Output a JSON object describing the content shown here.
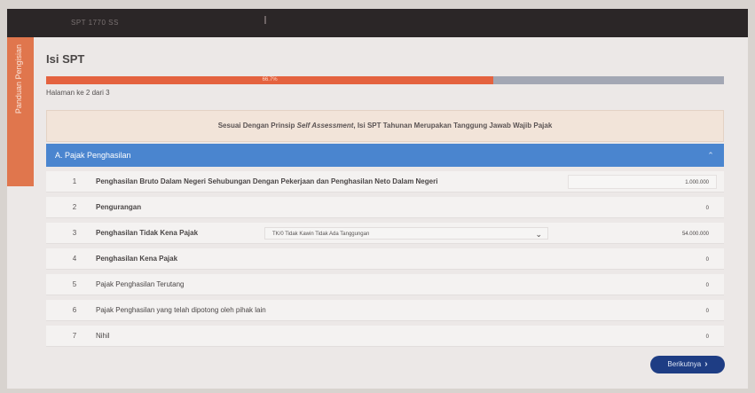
{
  "top_bar": {
    "brand": "SPT 1770 SS"
  },
  "side_tab": {
    "label": "Panduan Pengisian"
  },
  "page": {
    "title": "Isi SPT",
    "page_counter": "Halaman ke 2 dari 3"
  },
  "progress": {
    "percent": 66,
    "label": "66.7%"
  },
  "notice": {
    "prefix": "Sesuai Dengan Prinsip ",
    "emphasis": "Self Assessment",
    "suffix": ", Isi SPT Tahunan Merupakan Tanggung Jawab Wajib Pajak"
  },
  "section": {
    "title": "A. Pajak Penghasilan",
    "collapse_icon": "chevron-up-icon"
  },
  "rows": [
    {
      "num": "1",
      "label": "Penghasilan Bruto Dalam Negeri Sehubungan Dengan Pekerjaan dan Penghasilan Neto Dalam Negeri",
      "value": "1.000.000",
      "boxed": true
    },
    {
      "num": "2",
      "label": "Pengurangan",
      "value": "0",
      "boxed": false
    },
    {
      "num": "3",
      "label": "Penghasilan Tidak Kena Pajak",
      "value": "54.000.000",
      "boxed": false,
      "select_value": "TK/0 Tidak Kawin Tidak Ada Tanggungan"
    },
    {
      "num": "4",
      "label": "Penghasilan Kena Pajak",
      "value": "0",
      "boxed": false
    },
    {
      "num": "5",
      "label": "Pajak Penghasilan Terutang",
      "value": "0",
      "boxed": false
    },
    {
      "num": "6",
      "label": "Pajak Penghasilan yang telah dipotong oleh pihak lain",
      "value": "0",
      "boxed": false
    },
    {
      "num": "7",
      "label": "Nihil",
      "value": "0",
      "boxed": false
    }
  ],
  "actions": {
    "next_label": "Berikutnya",
    "next_icon": "chevron-right-icon"
  },
  "colors": {
    "accent_orange": "#e4623f",
    "section_blue": "#4a85cf",
    "button_navy": "#1e3d84"
  }
}
